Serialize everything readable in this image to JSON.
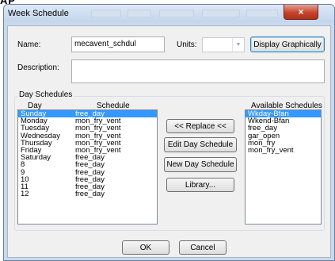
{
  "window": {
    "title": "Week Schedule",
    "close_glyph": "×"
  },
  "top_fragment": "AP",
  "form": {
    "name_label": "Name:",
    "name_value": "mecavent_schdul",
    "units_label": "Units:",
    "units_value": "",
    "display_graphically": "Display Graphically",
    "description_label": "Description:",
    "description_value": ""
  },
  "day_schedules": {
    "group_label": "Day Schedules",
    "header_day": "Day",
    "header_schedule": "Schedule",
    "rows": [
      {
        "day": "Sunday",
        "schedule": "free_day"
      },
      {
        "day": "Monday",
        "schedule": "mon_fry_vent"
      },
      {
        "day": "Tuesday",
        "schedule": "mon_fry_vent"
      },
      {
        "day": "Wednesday",
        "schedule": "mon_fry_vent"
      },
      {
        "day": "Thursday",
        "schedule": "mon_fry_vent"
      },
      {
        "day": "Friday",
        "schedule": "mon_fry_vent"
      },
      {
        "day": "Saturday",
        "schedule": "free_day"
      },
      {
        "day": "8",
        "schedule": "free_day"
      },
      {
        "day": "9",
        "schedule": "free_day"
      },
      {
        "day": "10",
        "schedule": "free_day"
      },
      {
        "day": "11",
        "schedule": "free_day"
      },
      {
        "day": "12",
        "schedule": "free_day"
      }
    ],
    "selected_index": 0
  },
  "buttons": {
    "replace": "<< Replace <<",
    "edit_day": "Edit Day Schedule",
    "new_day": "New Day Schedule",
    "library": "Library...",
    "ok": "OK",
    "cancel": "Cancel"
  },
  "available": {
    "header": "Available Schedules",
    "items": [
      "Wkday-Bfan",
      "Wkend-Bfan",
      "free_day",
      "gar_open",
      "mon_fry",
      "mon_fry_vent"
    ],
    "selected_index": 0
  },
  "colors": {
    "selection": "#3399ff",
    "close_button": "#c5432b",
    "window_frame": "#c8d9ee"
  }
}
